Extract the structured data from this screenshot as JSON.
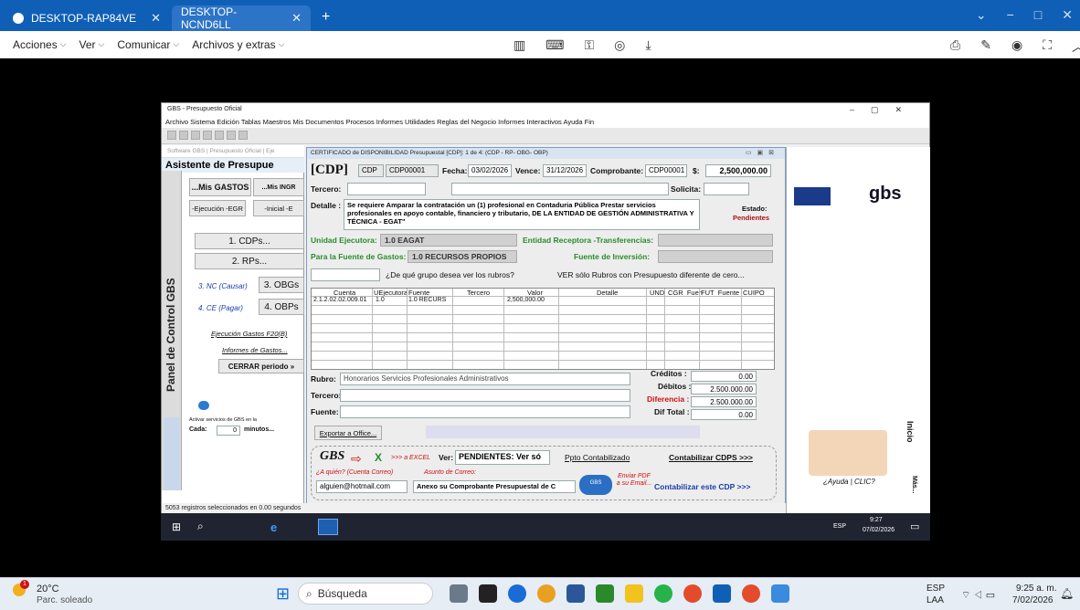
{
  "remote_tabs": [
    {
      "label": "DESKTOP-RAP84VE"
    },
    {
      "label": "DESKTOP-NCND6LL"
    }
  ],
  "remote_menu": [
    {
      "label": "Acciones"
    },
    {
      "label": "Ver"
    },
    {
      "label": "Comunicar"
    },
    {
      "label": "Archivos y extras"
    }
  ],
  "gbs": {
    "title": "GBS - Presupuesto Oficial",
    "menu": "Archivo  Sistema  Edición  Tablas  Maestros  Mis Documentos  Procesos  Informes  Utilidades  Reglas del Negocio  Informes Interactivos  Ayuda  Fin",
    "status": "5053 registros seleccionados en 0.00 segundos"
  },
  "panel": {
    "header": "Software GBS | Presupuesto Oficial | Eje",
    "asistente": "Asistente de Presupue",
    "vertical_label": "Panel de Control GBS",
    "tab_gastos": "...Mis GASTOS",
    "tab_ingr": "...Mis INGR",
    "tab_ejec": "-Ejecución -EGR",
    "tab_inicial": "-Inicial -E",
    "btn_cdps": "1. CDPs...",
    "btn_rps": "2. RPs...",
    "link_nc": "3. NC (Causar)",
    "btn_obg": "3. OBGs",
    "link_ce": "4. CE (Pagar)",
    "btn_obp": "4. OBPs",
    "link_ejec": "Ejecución Gastos F20(B)",
    "link_inf": "Informes de Gastos...",
    "btn_cerrar": "CERRAR periodo »",
    "activar": "Activar servicios de GBS en la",
    "cada": "Cada:",
    "cada_val": "0",
    "minutos": "minutos..."
  },
  "cdp": {
    "title": "CERTIFICADO de DISPONIBILIDAD Presupuestal [CDP]: 1 de 4: (CDP - RP- OBG- OBP)",
    "code": "[CDP]",
    "tipo": "CDP",
    "numero": "CDP00001",
    "fecha_label": "Fecha:",
    "fecha": "03/02/2026",
    "vence_label": "Vence:",
    "vence": "31/12/2026",
    "comprobante_label": "Comprobante:",
    "comprobante": "CDP00001",
    "monto_label": "$:",
    "monto": "2,500,000.00",
    "tercero_label": "Tercero:",
    "solicita_label": "Solicita:",
    "detalle_label": "Detalle :",
    "detalle": "Se requiere Amparar la contratación un (1) profesional en Contaduria Pública Prestar servicios profesionales en apoyo contable, financiero y tributario, DE LA ENTIDAD DE GESTIÓN ADMINISTRATIVA Y TÉCNICA - EGAT\"",
    "estado_label": "Estado:",
    "estado": "Pendientes",
    "unidad_label": "Unidad Ejecutora:",
    "unidad": "1.0 EAGAT",
    "entidad_label": "Entidad Receptora -Transferencias:",
    "fuente_gastos_label": "Para la Fuente de Gastos:",
    "fuente_gastos": "1.0 RECURSOS PROPIOS",
    "fuente_inv_label": "Fuente de Inversión:",
    "grupo_q": "¿De qué grupo desea ver los rubros?",
    "ver_solo": "VER sólo Rubros con Presupuesto diferente de cero...",
    "grid_headers": [
      "Cuenta",
      "UEjecutora",
      "Fuente",
      "Tercero",
      "Valor",
      "Detalle",
      "UND",
      "CGR_Fuen",
      "FUT_Fuente",
      "CUIPO"
    ],
    "grid_row": {
      "cuenta": "2.1.2.02.02.009.01",
      "uejec": "1.0",
      "fuente": "1.0 RECURS",
      "valor": "2,500,000.00"
    },
    "rubro_label": "Rubro:",
    "rubro": "Honorarios Servicios Profesionales Administrativos",
    "tercero2_label": "Tercero:",
    "fuente_label": "Fuente:",
    "creditos_label": "Créditos :",
    "creditos": "0.00",
    "debitos_label": "Débitos :",
    "debitos": "2.500.000.00",
    "diferencia_label": "Diferencia :",
    "diferencia": "2.500.000.00",
    "dif_total_label": "Dif Total :",
    "dif_total": "0.00",
    "exportar": "Exportar a Office...",
    "excel": ">>> a EXCEL",
    "ver_label": "Ver:",
    "ver_val": "PENDIENTES: Ver só",
    "ppto_cont": "Ppto Contabilizado",
    "contabilizar_cdps": "Contabilizar CDPS >>>",
    "a_quien": "¿A quién? (Cuenta Correo)",
    "asunto": "Asunto de Correo:",
    "email": "alguien@hotmail.com",
    "asunto_val": "Anexo su Comprobante Presupuestal de C",
    "enviar": "Enviar PDF a su Email...",
    "contabilizar_este": "Contabilizar este CDP >>>"
  },
  "rpane": {
    "inicio": "Inicio",
    "ayuda": "¿Ayuda | CLIC?",
    "mas": "Más..."
  },
  "remote_taskbar": {
    "lang": "ESP",
    "time": "9:27",
    "date": "07/02/2026"
  },
  "taskbar": {
    "temp": "20°C",
    "weather": "Parc. soleado",
    "weather_badge": "1",
    "search": "Búsqueda",
    "lang": "ESP",
    "lang2": "LAA",
    "time": "9:25 a. m.",
    "date": "7/02/2026"
  },
  "colors": {
    "accent": "#0f5fb7",
    "green_label": "#2c8a2c",
    "link_blue": "#1a3da8",
    "red": "#d01010"
  }
}
